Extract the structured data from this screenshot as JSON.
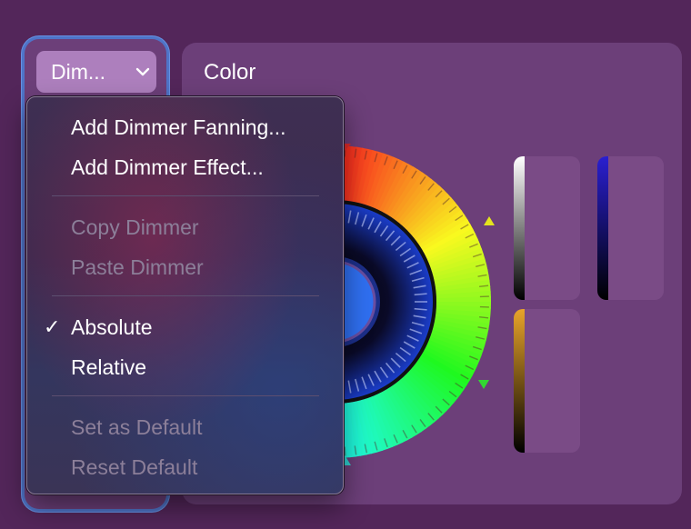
{
  "dimmer": {
    "button_label": "Dim..."
  },
  "color_panel": {
    "title": "Color"
  },
  "menu": {
    "groups": [
      {
        "items": [
          {
            "label": "Add Dimmer Fanning...",
            "enabled": true
          },
          {
            "label": "Add Dimmer Effect...",
            "enabled": true
          }
        ]
      },
      {
        "items": [
          {
            "label": "Copy Dimmer",
            "enabled": false
          },
          {
            "label": "Paste Dimmer",
            "enabled": false
          }
        ]
      },
      {
        "items": [
          {
            "label": "Absolute",
            "enabled": true,
            "checked": true
          },
          {
            "label": "Relative",
            "enabled": true,
            "checked": false
          }
        ]
      },
      {
        "items": [
          {
            "label": "Set as Default",
            "enabled": false
          },
          {
            "label": "Reset Default",
            "enabled": false
          }
        ]
      }
    ],
    "check_glyph": "✓"
  },
  "colors": {
    "background": "#53265a",
    "panel": "#6c3f79",
    "focus_ring": "#4f74c8",
    "dimmer_button": "#ad7fbd",
    "white_strip": "#ffffff",
    "blue_strip": "#2a1fd0",
    "amber_strip": "#e8a42a"
  }
}
